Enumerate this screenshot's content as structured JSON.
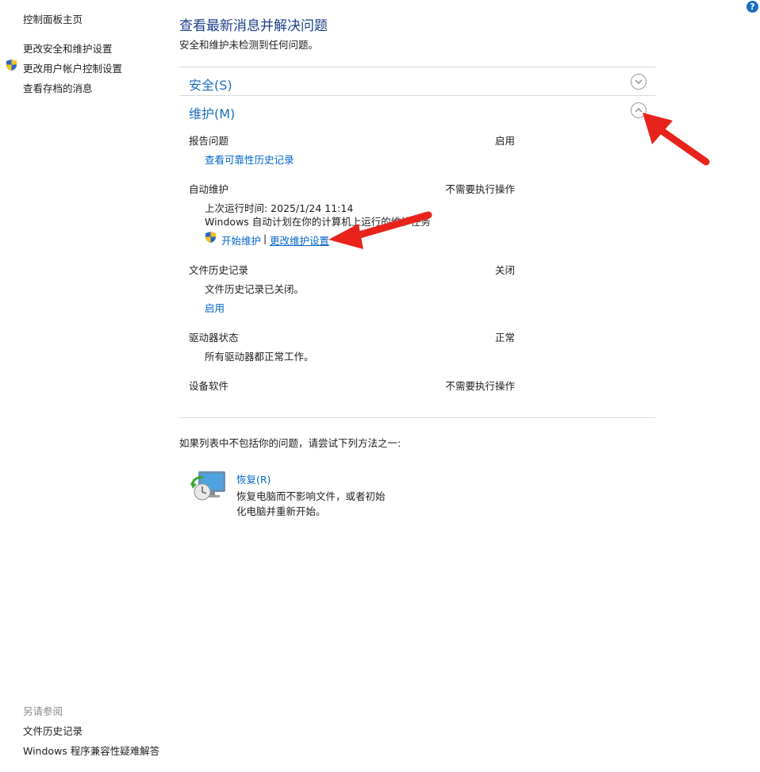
{
  "nav": {
    "home": "控制面板主页",
    "change_security": "更改安全和维护设置",
    "change_uac": "更改用户帐户控制设置",
    "archived": "查看存档的消息"
  },
  "see_also": {
    "heading": "另请参阅",
    "file_history": "文件历史记录",
    "compat": "Windows 程序兼容性疑难解答"
  },
  "help_label": "?",
  "main": {
    "title": "查看最新消息并解决问题",
    "subtitle": "安全和维护未检测到任何问题。",
    "security_header": "安全(S)",
    "maintenance_header": "维护(M)"
  },
  "maintenance": {
    "report": {
      "label": "报告问题",
      "status": "启用",
      "link": "查看可靠性历史记录"
    },
    "auto": {
      "label": "自动维护",
      "status": "不需要执行操作",
      "last_run": "上次运行时间: 2025/1/24 11:14",
      "desc": "Windows 自动计划在你的计算机上运行的维护任务。",
      "start_link": "开始维护",
      "separator": "|",
      "settings_link": "更改维护设置"
    },
    "file_history": {
      "label": "文件历史记录",
      "status": "关闭",
      "desc": "文件历史记录已关闭。",
      "link": "启用"
    },
    "drive": {
      "label": "驱动器状态",
      "status": "正常",
      "desc": "所有驱动器都正常工作。"
    },
    "device_software": {
      "label": "设备软件",
      "status": "不需要执行操作"
    }
  },
  "recovery": {
    "hint": "如果列表中不包括你的问题，请尝试下列方法之一:",
    "title": "恢复(R)",
    "desc": "恢复电脑而不影响文件，或者初始化电脑并重新开始。"
  },
  "colors": {
    "link": "#0066cc",
    "heading": "#1a6ebf",
    "arrow": "#e8231c"
  }
}
